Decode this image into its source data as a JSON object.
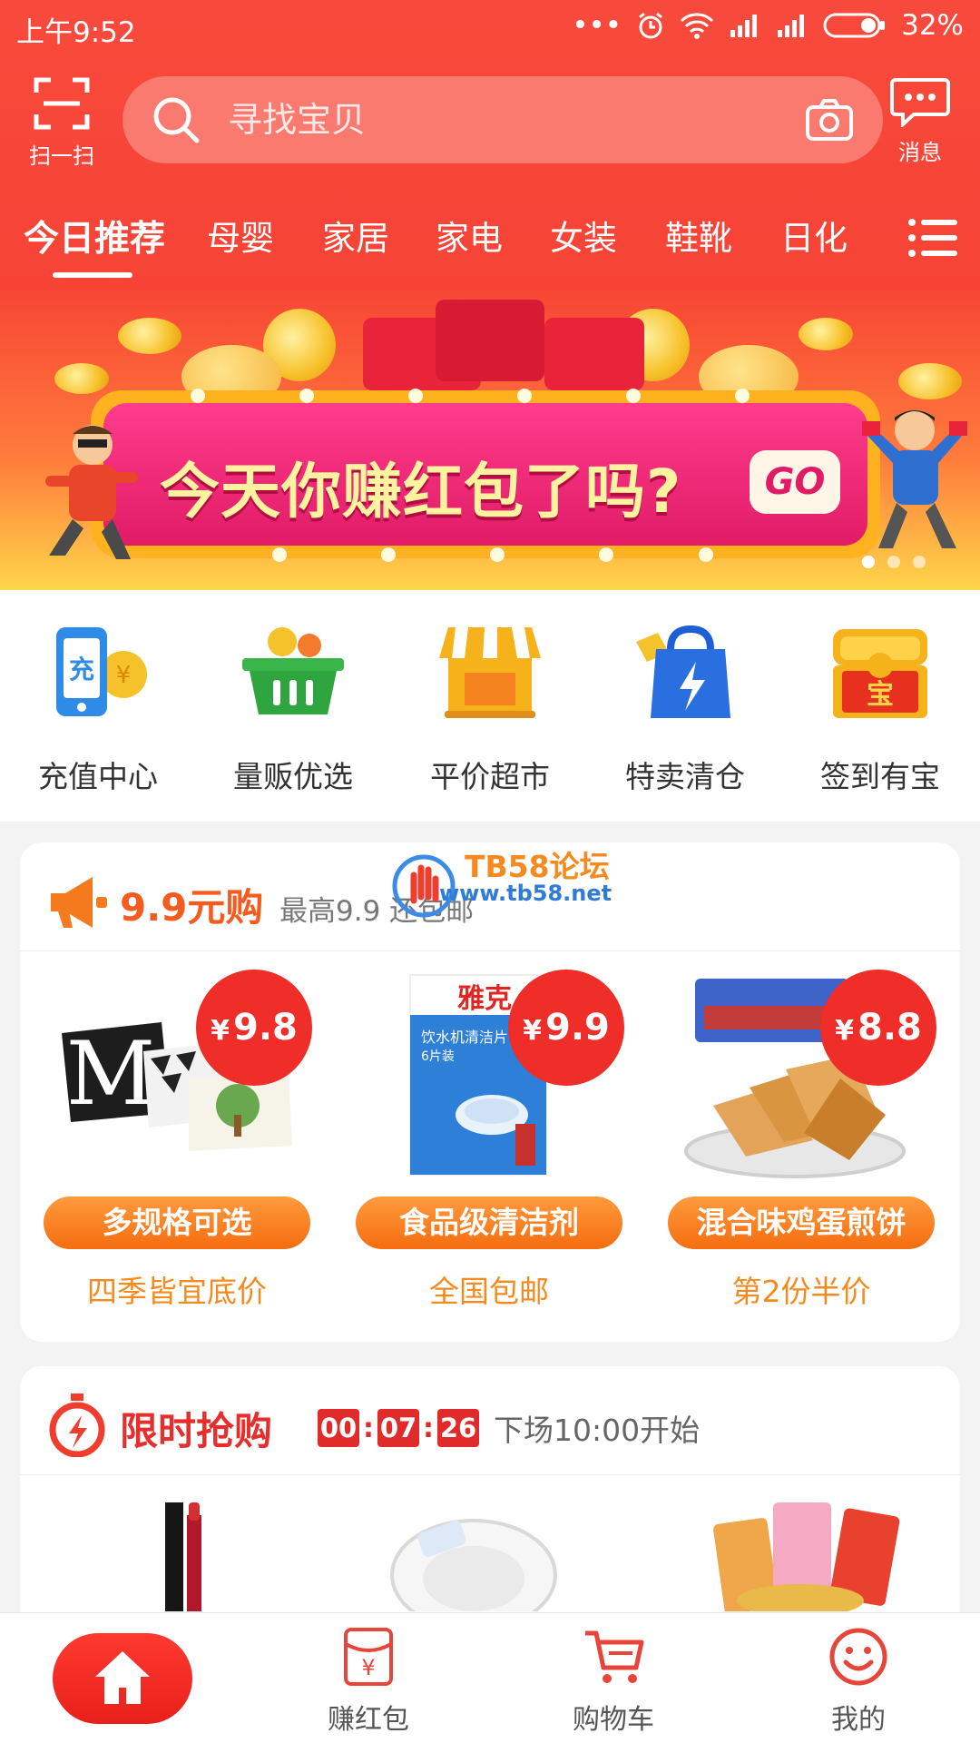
{
  "status": {
    "time": "上午9:52",
    "dots": "•••",
    "battery": "32%"
  },
  "topbar": {
    "scan_label": "扫一扫",
    "search_placeholder": "寻找宝贝",
    "message_label": "消息"
  },
  "categories": [
    "今日推荐",
    "母婴",
    "家居",
    "家电",
    "女装",
    "鞋靴",
    "日化"
  ],
  "banner": {
    "headline": "今天你赚红包了吗?",
    "go": "GO"
  },
  "quick": [
    {
      "label": "充值中心",
      "icon": "phone-recharge-icon"
    },
    {
      "label": "量贩优选",
      "icon": "basket-icon"
    },
    {
      "label": "平价超市",
      "icon": "store-icon"
    },
    {
      "label": "特卖清仓",
      "icon": "sale-bag-icon"
    },
    {
      "label": "签到有宝",
      "icon": "treasure-chest-icon"
    }
  ],
  "deal99": {
    "title": "9.9元购",
    "subtitle": "最高9.9 还包邮",
    "watermark_title": "TB58论坛",
    "watermark_url": "www.tb58.net",
    "products": [
      {
        "price": "9.8",
        "tag": "多规格可选",
        "note": "四季皆宜底价",
        "image": "cushion-pillows-image"
      },
      {
        "price": "9.9",
        "tag": "食品级清洁剂",
        "note": "全国包邮",
        "image": "cleaning-tablets-box-image"
      },
      {
        "price": "8.8",
        "tag": "混合味鸡蛋煎饼",
        "note": "第2份半价",
        "image": "egg-pancake-snack-image"
      }
    ],
    "packaging_text": {
      "brand": "雅克",
      "line1": "饮水机清洁片",
      "line2": "6片装"
    }
  },
  "flash": {
    "title": "限时抢购",
    "hours": "00",
    "minutes": "07",
    "seconds": "26",
    "next": "下场10:00开始"
  },
  "nav": {
    "items": [
      {
        "label": "",
        "icon": "home-icon"
      },
      {
        "label": "赚红包",
        "icon": "red-envelope-icon"
      },
      {
        "label": "购物车",
        "icon": "cart-icon"
      },
      {
        "label": "我的",
        "icon": "smiley-icon"
      }
    ]
  },
  "colors": {
    "primary": "#f64336",
    "accent_orange": "#f56d10",
    "price_red": "#ef2d29"
  }
}
